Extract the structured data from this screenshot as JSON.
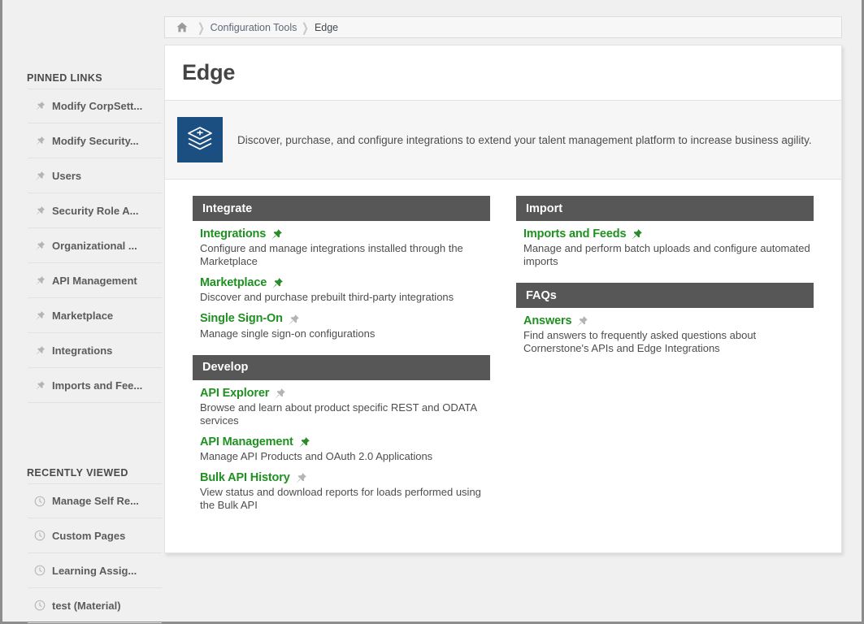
{
  "breadcrumb": {
    "home_icon": "home-icon",
    "items": [
      {
        "label": "Configuration Tools",
        "current": false
      },
      {
        "label": "Edge",
        "current": true
      }
    ]
  },
  "sidebar": {
    "pinned": {
      "title": "PINNED LINKS",
      "items": [
        {
          "label": "Modify CorpSett...",
          "icon": "pin-icon"
        },
        {
          "label": "Modify Security...",
          "icon": "pin-icon"
        },
        {
          "label": "Users",
          "icon": "pin-icon"
        },
        {
          "label": "Security Role A...",
          "icon": "pin-icon"
        },
        {
          "label": "Organizational ...",
          "icon": "pin-icon"
        },
        {
          "label": "API Management",
          "icon": "pin-icon"
        },
        {
          "label": "Marketplace",
          "icon": "pin-icon"
        },
        {
          "label": "Integrations",
          "icon": "pin-icon"
        },
        {
          "label": "Imports and Fee...",
          "icon": "pin-icon"
        }
      ]
    },
    "recent": {
      "title": "RECENTLY VIEWED",
      "items": [
        {
          "label": "Manage Self Re...",
          "icon": "clock-icon"
        },
        {
          "label": "Custom Pages",
          "icon": "clock-icon"
        },
        {
          "label": "Learning Assig...",
          "icon": "clock-icon"
        },
        {
          "label": "test (Material)",
          "icon": "clock-icon"
        }
      ]
    }
  },
  "page": {
    "title": "Edge",
    "logo_icon": "layers-stack-icon",
    "description": "Discover, purchase, and configure integrations to extend your talent management platform to increase business agility."
  },
  "columns": {
    "left": [
      {
        "header": "Integrate",
        "links": [
          {
            "title": "Integrations",
            "pinned": true,
            "description": "Configure and manage integrations installed through the Marketplace"
          },
          {
            "title": "Marketplace",
            "pinned": true,
            "description": "Discover and purchase prebuilt third-party integrations"
          },
          {
            "title": "Single Sign-On",
            "pinned": false,
            "description": "Manage single sign-on configurations"
          }
        ]
      },
      {
        "header": "Develop",
        "links": [
          {
            "title": "API Explorer",
            "pinned": false,
            "description": "Browse and learn about product specific REST and ODATA services"
          },
          {
            "title": "API Management",
            "pinned": true,
            "description": "Manage API Products and OAuth 2.0 Applications"
          },
          {
            "title": "Bulk API History",
            "pinned": false,
            "description": "View status and download reports for loads performed using the Bulk API"
          }
        ]
      }
    ],
    "right": [
      {
        "header": "Import",
        "links": [
          {
            "title": "Imports and Feeds",
            "pinned": true,
            "description": "Manage and perform batch uploads and configure automated imports"
          }
        ]
      },
      {
        "header": "FAQs",
        "links": [
          {
            "title": "Answers",
            "pinned": false,
            "description": "Find answers to frequently asked questions about Cornerstone's APIs and Edge Integrations"
          }
        ]
      }
    ]
  },
  "colors": {
    "link_green": "#1f9021",
    "pin_green": "#2b8a2b",
    "pin_gray": "#b4b4b4",
    "group_header": "#575757",
    "logo_blue": "#1b4f82",
    "page_bg": "#f0f0f0"
  }
}
